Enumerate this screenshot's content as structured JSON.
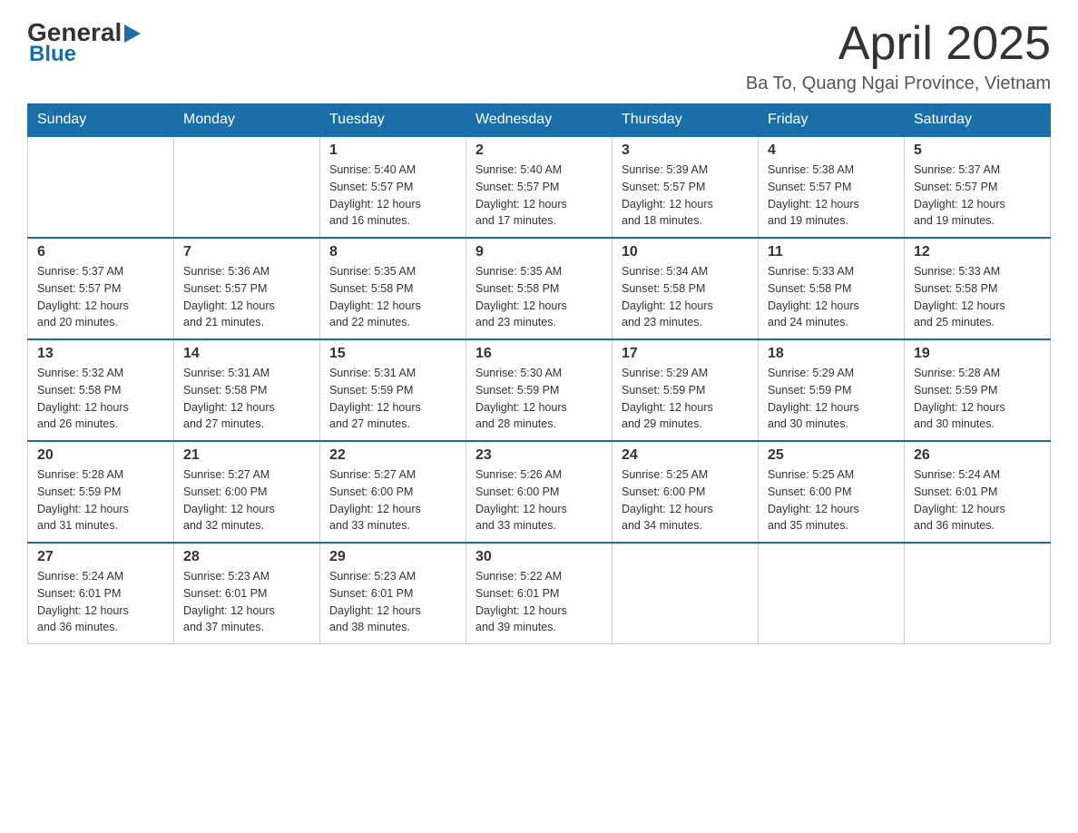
{
  "header": {
    "logo_general": "General",
    "logo_arrow": "▶",
    "logo_blue": "Blue",
    "month_title": "April 2025",
    "location": "Ba To, Quang Ngai Province, Vietnam"
  },
  "weekdays": [
    "Sunday",
    "Monday",
    "Tuesday",
    "Wednesday",
    "Thursday",
    "Friday",
    "Saturday"
  ],
  "weeks": [
    [
      {
        "day": "",
        "info": ""
      },
      {
        "day": "",
        "info": ""
      },
      {
        "day": "1",
        "info": "Sunrise: 5:40 AM\nSunset: 5:57 PM\nDaylight: 12 hours\nand 16 minutes."
      },
      {
        "day": "2",
        "info": "Sunrise: 5:40 AM\nSunset: 5:57 PM\nDaylight: 12 hours\nand 17 minutes."
      },
      {
        "day": "3",
        "info": "Sunrise: 5:39 AM\nSunset: 5:57 PM\nDaylight: 12 hours\nand 18 minutes."
      },
      {
        "day": "4",
        "info": "Sunrise: 5:38 AM\nSunset: 5:57 PM\nDaylight: 12 hours\nand 19 minutes."
      },
      {
        "day": "5",
        "info": "Sunrise: 5:37 AM\nSunset: 5:57 PM\nDaylight: 12 hours\nand 19 minutes."
      }
    ],
    [
      {
        "day": "6",
        "info": "Sunrise: 5:37 AM\nSunset: 5:57 PM\nDaylight: 12 hours\nand 20 minutes."
      },
      {
        "day": "7",
        "info": "Sunrise: 5:36 AM\nSunset: 5:57 PM\nDaylight: 12 hours\nand 21 minutes."
      },
      {
        "day": "8",
        "info": "Sunrise: 5:35 AM\nSunset: 5:58 PM\nDaylight: 12 hours\nand 22 minutes."
      },
      {
        "day": "9",
        "info": "Sunrise: 5:35 AM\nSunset: 5:58 PM\nDaylight: 12 hours\nand 23 minutes."
      },
      {
        "day": "10",
        "info": "Sunrise: 5:34 AM\nSunset: 5:58 PM\nDaylight: 12 hours\nand 23 minutes."
      },
      {
        "day": "11",
        "info": "Sunrise: 5:33 AM\nSunset: 5:58 PM\nDaylight: 12 hours\nand 24 minutes."
      },
      {
        "day": "12",
        "info": "Sunrise: 5:33 AM\nSunset: 5:58 PM\nDaylight: 12 hours\nand 25 minutes."
      }
    ],
    [
      {
        "day": "13",
        "info": "Sunrise: 5:32 AM\nSunset: 5:58 PM\nDaylight: 12 hours\nand 26 minutes."
      },
      {
        "day": "14",
        "info": "Sunrise: 5:31 AM\nSunset: 5:58 PM\nDaylight: 12 hours\nand 27 minutes."
      },
      {
        "day": "15",
        "info": "Sunrise: 5:31 AM\nSunset: 5:59 PM\nDaylight: 12 hours\nand 27 minutes."
      },
      {
        "day": "16",
        "info": "Sunrise: 5:30 AM\nSunset: 5:59 PM\nDaylight: 12 hours\nand 28 minutes."
      },
      {
        "day": "17",
        "info": "Sunrise: 5:29 AM\nSunset: 5:59 PM\nDaylight: 12 hours\nand 29 minutes."
      },
      {
        "day": "18",
        "info": "Sunrise: 5:29 AM\nSunset: 5:59 PM\nDaylight: 12 hours\nand 30 minutes."
      },
      {
        "day": "19",
        "info": "Sunrise: 5:28 AM\nSunset: 5:59 PM\nDaylight: 12 hours\nand 30 minutes."
      }
    ],
    [
      {
        "day": "20",
        "info": "Sunrise: 5:28 AM\nSunset: 5:59 PM\nDaylight: 12 hours\nand 31 minutes."
      },
      {
        "day": "21",
        "info": "Sunrise: 5:27 AM\nSunset: 6:00 PM\nDaylight: 12 hours\nand 32 minutes."
      },
      {
        "day": "22",
        "info": "Sunrise: 5:27 AM\nSunset: 6:00 PM\nDaylight: 12 hours\nand 33 minutes."
      },
      {
        "day": "23",
        "info": "Sunrise: 5:26 AM\nSunset: 6:00 PM\nDaylight: 12 hours\nand 33 minutes."
      },
      {
        "day": "24",
        "info": "Sunrise: 5:25 AM\nSunset: 6:00 PM\nDaylight: 12 hours\nand 34 minutes."
      },
      {
        "day": "25",
        "info": "Sunrise: 5:25 AM\nSunset: 6:00 PM\nDaylight: 12 hours\nand 35 minutes."
      },
      {
        "day": "26",
        "info": "Sunrise: 5:24 AM\nSunset: 6:01 PM\nDaylight: 12 hours\nand 36 minutes."
      }
    ],
    [
      {
        "day": "27",
        "info": "Sunrise: 5:24 AM\nSunset: 6:01 PM\nDaylight: 12 hours\nand 36 minutes."
      },
      {
        "day": "28",
        "info": "Sunrise: 5:23 AM\nSunset: 6:01 PM\nDaylight: 12 hours\nand 37 minutes."
      },
      {
        "day": "29",
        "info": "Sunrise: 5:23 AM\nSunset: 6:01 PM\nDaylight: 12 hours\nand 38 minutes."
      },
      {
        "day": "30",
        "info": "Sunrise: 5:22 AM\nSunset: 6:01 PM\nDaylight: 12 hours\nand 39 minutes."
      },
      {
        "day": "",
        "info": ""
      },
      {
        "day": "",
        "info": ""
      },
      {
        "day": "",
        "info": ""
      }
    ]
  ]
}
